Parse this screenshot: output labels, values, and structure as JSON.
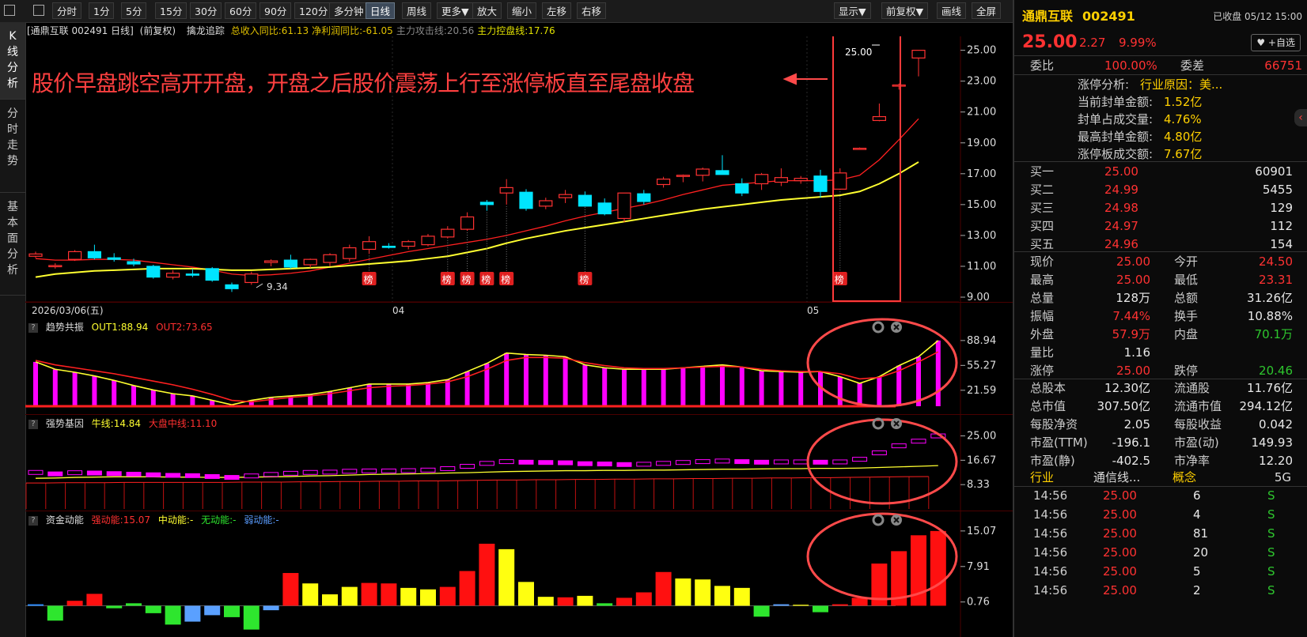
{
  "toolbar": {
    "periods": [
      "分时",
      "1分",
      "5分",
      "15分",
      "30分",
      "60分",
      "90分",
      "120分",
      "多分钟",
      "日线",
      "周线",
      "更多▼"
    ],
    "active_period": "日线",
    "actions": [
      "放大",
      "缩小",
      "左移",
      "右移"
    ],
    "right_actions": [
      "显示▼",
      "前复权▼",
      "画线",
      "全屏"
    ]
  },
  "left_tabs": [
    {
      "label": "K线分析",
      "active": true
    },
    {
      "label": "分时走势",
      "active": false
    },
    {
      "label": "基本面分析",
      "active": false
    }
  ],
  "main_chart": {
    "title": "[通鼎互联 002491 日线]",
    "adjust": "(前复权)",
    "indicator_name": "擒龙追踪",
    "indicator_values": [
      {
        "text": "总收入同比:61.13",
        "color": "#e0c000"
      },
      {
        "text": "净利润同比:-61.05",
        "color": "#e0c000"
      },
      {
        "text": "主力攻击线:20.56",
        "color": "#888888"
      },
      {
        "text": "主力控盘线:17.76",
        "color": "#e0e000"
      }
    ],
    "annotation": "股价早盘跳空高开开盘，开盘之后股价震荡上行至涨停板直至尾盘收盘",
    "last_price_label": "25.00",
    "low_label": "9.34",
    "badge_label": "榜",
    "date_labels": [
      "2026/03/06(五)",
      "04",
      "05"
    ]
  },
  "chart_data": [
    {
      "type": "candlestick",
      "title": "通鼎互联 002491 日线",
      "ylim": [
        9.0,
        25.8
      ],
      "y_ticks": [
        "25.00",
        "23.00",
        "21.00",
        "19.00",
        "17.00",
        "15.00",
        "13.00",
        "11.00",
        "9.00"
      ],
      "candles": [
        [
          11.65,
          11.95,
          11.55,
          11.8
        ],
        [
          11.0,
          11.2,
          10.85,
          11.05
        ],
        [
          11.45,
          12.05,
          11.35,
          11.95
        ],
        [
          11.95,
          12.4,
          11.45,
          11.55
        ],
        [
          11.55,
          11.85,
          11.3,
          11.45
        ],
        [
          11.3,
          11.5,
          11.0,
          11.15
        ],
        [
          11.0,
          11.1,
          10.2,
          10.3
        ],
        [
          10.3,
          10.75,
          10.15,
          10.55
        ],
        [
          10.5,
          10.85,
          10.3,
          10.45
        ],
        [
          10.85,
          10.95,
          10.0,
          10.1
        ],
        [
          9.8,
          9.95,
          9.34,
          9.55
        ],
        [
          9.95,
          10.65,
          9.8,
          10.5
        ],
        [
          11.25,
          11.45,
          11.0,
          11.35
        ],
        [
          11.4,
          11.75,
          10.85,
          10.95
        ],
        [
          11.1,
          11.5,
          10.9,
          11.45
        ],
        [
          11.25,
          11.85,
          11.0,
          11.75
        ],
        [
          11.5,
          12.4,
          11.3,
          12.2
        ],
        [
          12.1,
          12.95,
          11.8,
          12.6
        ],
        [
          12.3,
          12.5,
          12.15,
          12.25
        ],
        [
          12.3,
          12.7,
          12.1,
          12.6
        ],
        [
          12.4,
          13.1,
          12.3,
          12.95
        ],
        [
          12.9,
          13.6,
          12.8,
          13.4
        ],
        [
          13.4,
          14.5,
          13.3,
          14.2
        ],
        [
          15.15,
          15.3,
          14.6,
          15.0
        ],
        [
          15.75,
          16.65,
          15.0,
          16.1
        ],
        [
          15.8,
          16.0,
          14.6,
          14.75
        ],
        [
          14.9,
          15.45,
          14.7,
          15.25
        ],
        [
          15.45,
          15.95,
          15.1,
          15.65
        ],
        [
          15.6,
          15.85,
          14.95,
          14.9
        ],
        [
          15.1,
          15.4,
          14.3,
          14.4
        ],
        [
          14.1,
          15.75,
          13.85,
          15.75
        ],
        [
          15.7,
          15.95,
          15.0,
          15.2
        ],
        [
          16.3,
          16.8,
          16.1,
          16.65
        ],
        [
          16.85,
          16.95,
          16.45,
          16.9
        ],
        [
          16.9,
          17.4,
          16.5,
          17.3
        ],
        [
          17.2,
          18.2,
          16.95,
          16.95
        ],
        [
          16.35,
          16.7,
          15.55,
          15.75
        ],
        [
          16.35,
          17.05,
          15.95,
          16.95
        ],
        [
          16.45,
          17.35,
          16.2,
          16.75
        ],
        [
          16.55,
          16.85,
          16.35,
          16.7
        ],
        [
          16.85,
          17.25,
          15.45,
          15.85
        ],
        [
          16.0,
          17.35,
          15.95,
          17.05
        ],
        [
          18.65,
          18.7,
          18.6,
          18.65
        ],
        [
          20.45,
          21.55,
          20.4,
          20.7
        ],
        [
          22.7,
          22.85,
          22.45,
          22.75
        ],
        [
          24.5,
          25.0,
          23.31,
          25.0
        ]
      ],
      "series": [
        {
          "name": "主力攻击线",
          "values": [
            11.5,
            11.4,
            11.4,
            11.45,
            11.45,
            11.4,
            11.25,
            11.1,
            10.95,
            10.75,
            10.5,
            10.4,
            10.45,
            10.55,
            10.7,
            10.95,
            11.2,
            11.45,
            11.7,
            11.95,
            12.15,
            12.35,
            12.55,
            12.75,
            13.0,
            13.3,
            13.6,
            13.95,
            14.25,
            14.5,
            14.75,
            15.0,
            15.3,
            15.65,
            15.95,
            16.25,
            16.35,
            16.45,
            16.55,
            16.55,
            16.55,
            16.6,
            16.9,
            17.9,
            19.2,
            20.56
          ]
        },
        {
          "name": "主力控盘线",
          "values": [
            10.3,
            10.5,
            10.6,
            10.7,
            10.75,
            10.8,
            10.85,
            10.85,
            10.85,
            10.8,
            10.75,
            10.75,
            10.8,
            10.85,
            10.9,
            10.95,
            11.05,
            11.15,
            11.25,
            11.35,
            11.5,
            11.65,
            11.9,
            12.15,
            12.5,
            12.8,
            13.05,
            13.3,
            13.5,
            13.7,
            13.9,
            14.1,
            14.3,
            14.5,
            14.7,
            14.85,
            15.0,
            15.15,
            15.3,
            15.4,
            15.5,
            15.6,
            15.85,
            16.35,
            17.0,
            17.76
          ]
        }
      ]
    },
    {
      "type": "bar",
      "title": "趋势共振",
      "y_ticks": [
        "88.94",
        "55.27",
        "21.59"
      ],
      "ylim": [
        0,
        92
      ],
      "series": [
        {
          "name": "OUT1",
          "values": [
            60,
            50,
            46,
            41,
            35,
            28,
            22,
            17,
            14,
            8,
            2,
            8,
            12,
            14,
            16,
            20,
            25,
            30,
            30,
            30,
            32,
            36,
            47,
            58,
            72,
            70,
            69,
            67,
            56,
            52,
            50,
            50,
            50,
            52,
            54,
            56,
            53,
            48,
            47,
            46,
            47,
            40,
            31,
            40,
            55,
            67,
            88.94
          ]
        },
        {
          "name": "OUT2",
          "values": [
            62,
            56,
            52,
            48,
            44,
            39,
            34,
            29,
            23,
            16,
            8,
            6,
            9,
            12,
            14,
            17,
            21,
            25,
            27,
            28,
            30,
            33,
            40,
            50,
            62,
            66,
            66,
            65,
            59,
            55,
            52,
            51,
            51,
            52,
            53,
            54,
            53,
            50,
            48,
            47,
            47,
            44,
            37,
            39,
            48,
            60,
            73.65
          ]
        }
      ]
    },
    {
      "type": "bar",
      "title": "强势基因",
      "y_ticks": [
        "25.00",
        "16.67",
        "8.33"
      ],
      "ylim": [
        0,
        26.5
      ],
      "series": [
        {
          "name": "牛线",
          "values": [
            14.84
          ]
        },
        {
          "name": "大盘中线",
          "values": [
            11.1
          ]
        }
      ]
    },
    {
      "type": "bar",
      "title": "资金动能",
      "y_ticks": [
        "15.07",
        "7.91",
        "0.76"
      ],
      "ylim": [
        -5.5,
        16
      ],
      "series": [
        {
          "name": "强动能",
          "values": [
            15.07
          ]
        }
      ]
    }
  ],
  "panel2": {
    "name": "趋势共振",
    "out1": "OUT1:88.94",
    "out2": "OUT2:73.65"
  },
  "panel3": {
    "name": "强势基因",
    "bull": "牛线:14.84",
    "mid": "大盘中线:11.10"
  },
  "panel4": {
    "name": "资金动能",
    "strong": "强动能:15.07",
    "medium": "中动能:-",
    "none": "无动能:-",
    "weak": "弱动能:-"
  },
  "colors": {
    "up": "#ff3232",
    "down": "#00e5ff",
    "attack": "#ff2020",
    "control": "#ffff30",
    "magenta": "#ff00ff",
    "annot": "#ff4040"
  },
  "right": {
    "name": "通鼎互联",
    "code": "002491",
    "status": "已收盘 05/12 15:00",
    "price": "25.00",
    "change": "2.27",
    "pct": "9.99%",
    "fav": "♥ +自选",
    "weibi_label": "委比",
    "weibi": "100.00%",
    "weicha_label": "委差",
    "weicha": "66751",
    "limit_info": [
      {
        "label": "涨停分析:",
        "value": "行业原因：美..."
      },
      {
        "label": "当前封单金额:",
        "value": "1.52亿"
      },
      {
        "label": "封单占成交量:",
        "value": "4.76%"
      },
      {
        "label": "最高封单金额:",
        "value": "4.80亿"
      },
      {
        "label": "涨停板成交额:",
        "value": "7.67亿"
      }
    ],
    "buys": [
      {
        "label": "买一",
        "price": "25.00",
        "vol": "60901"
      },
      {
        "label": "买二",
        "price": "24.99",
        "vol": "5455"
      },
      {
        "label": "买三",
        "price": "24.98",
        "vol": "129"
      },
      {
        "label": "买四",
        "price": "24.97",
        "vol": "112"
      },
      {
        "label": "买五",
        "price": "24.96",
        "vol": "154"
      }
    ],
    "quote": [
      {
        "l1": "现价",
        "v1": "25.00",
        "c1": "#ff3232",
        "l2": "今开",
        "v2": "24.50",
        "c2": "#ff3232"
      },
      {
        "l1": "最高",
        "v1": "25.00",
        "c1": "#ff3232",
        "l2": "最低",
        "v2": "23.31",
        "c2": "#ff3232"
      },
      {
        "l1": "总量",
        "v1": "128万",
        "c1": "#e8e8e8",
        "l2": "总额",
        "v2": "31.26亿",
        "c2": "#e8e8e8"
      },
      {
        "l1": "振幅",
        "v1": "7.44%",
        "c1": "#ff3232",
        "l2": "换手",
        "v2": "10.88%",
        "c2": "#e8e8e8"
      },
      {
        "l1": "外盘",
        "v1": "57.9万",
        "c1": "#ff3232",
        "l2": "内盘",
        "v2": "70.1万",
        "c2": "#2ec62e"
      },
      {
        "l1": "量比",
        "v1": "1.16",
        "c1": "#e8e8e8",
        "l2": "",
        "v2": "",
        "c2": "#e8e8e8"
      },
      {
        "l1": "涨停",
        "v1": "25.00",
        "c1": "#ff3232",
        "l2": "跌停",
        "v2": "20.46",
        "c2": "#2ec62e"
      }
    ],
    "fundamentals": [
      {
        "l1": "总股本",
        "v1": "12.30亿",
        "l2": "流通股",
        "v2": "11.76亿"
      },
      {
        "l1": "总市值",
        "v1": "307.50亿",
        "l2": "流通市值",
        "v2": "294.12亿"
      },
      {
        "l1": "每股净资",
        "v1": "2.05",
        "l2": "每股收益",
        "v2": "0.042"
      },
      {
        "l1": "市盈(TTM)",
        "v1": "-196.1",
        "l2": "市盈(动)",
        "v2": "149.93"
      },
      {
        "l1": "市盈(静)",
        "v1": "-402.5",
        "l2": "市净率",
        "v2": "12.20"
      }
    ],
    "industry": {
      "l1": "行业",
      "v1": "通信线...",
      "l2": "概念",
      "v2": "5G"
    },
    "ticks": [
      {
        "time": "14:56",
        "price": "25.00",
        "vol": "6",
        "side": "S"
      },
      {
        "time": "14:56",
        "price": "25.00",
        "vol": "4",
        "side": "S"
      },
      {
        "time": "14:56",
        "price": "25.00",
        "vol": "81",
        "side": "S"
      },
      {
        "time": "14:56",
        "price": "25.00",
        "vol": "20",
        "side": "S"
      },
      {
        "time": "14:56",
        "price": "25.00",
        "vol": "5",
        "side": "S"
      },
      {
        "time": "14:56",
        "price": "25.00",
        "vol": "2",
        "side": "S"
      }
    ]
  }
}
